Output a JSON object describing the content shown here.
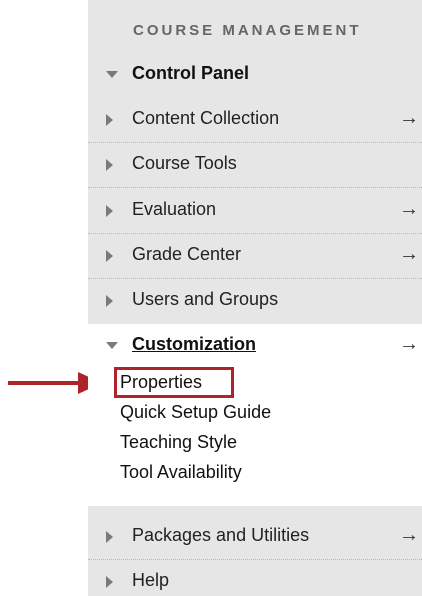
{
  "menu": {
    "section_title": "COURSE MANAGEMENT",
    "control_panel": "Control Panel",
    "items": [
      {
        "label": "Content Collection",
        "has_arrow": true
      },
      {
        "label": "Course Tools",
        "has_arrow": false
      },
      {
        "label": "Evaluation",
        "has_arrow": true
      },
      {
        "label": "Grade Center",
        "has_arrow": true
      },
      {
        "label": "Users and Groups",
        "has_arrow": false
      }
    ],
    "customization": {
      "label": "Customization",
      "sub_items": [
        "Properties",
        "Quick Setup Guide",
        "Teaching Style",
        "Tool Availability"
      ],
      "highlighted": "Properties"
    },
    "packages": "Packages and Utilities",
    "help": "Help",
    "arrow_glyph": "→"
  },
  "colors": {
    "panel_bg": "#e6e6e6",
    "highlight": "#b0232a"
  },
  "icons": {
    "expand": "triangle-right-icon",
    "collapse": "triangle-down-icon",
    "open_submenu": "arrow-right-icon",
    "annotation": "red-pointer-arrow"
  }
}
